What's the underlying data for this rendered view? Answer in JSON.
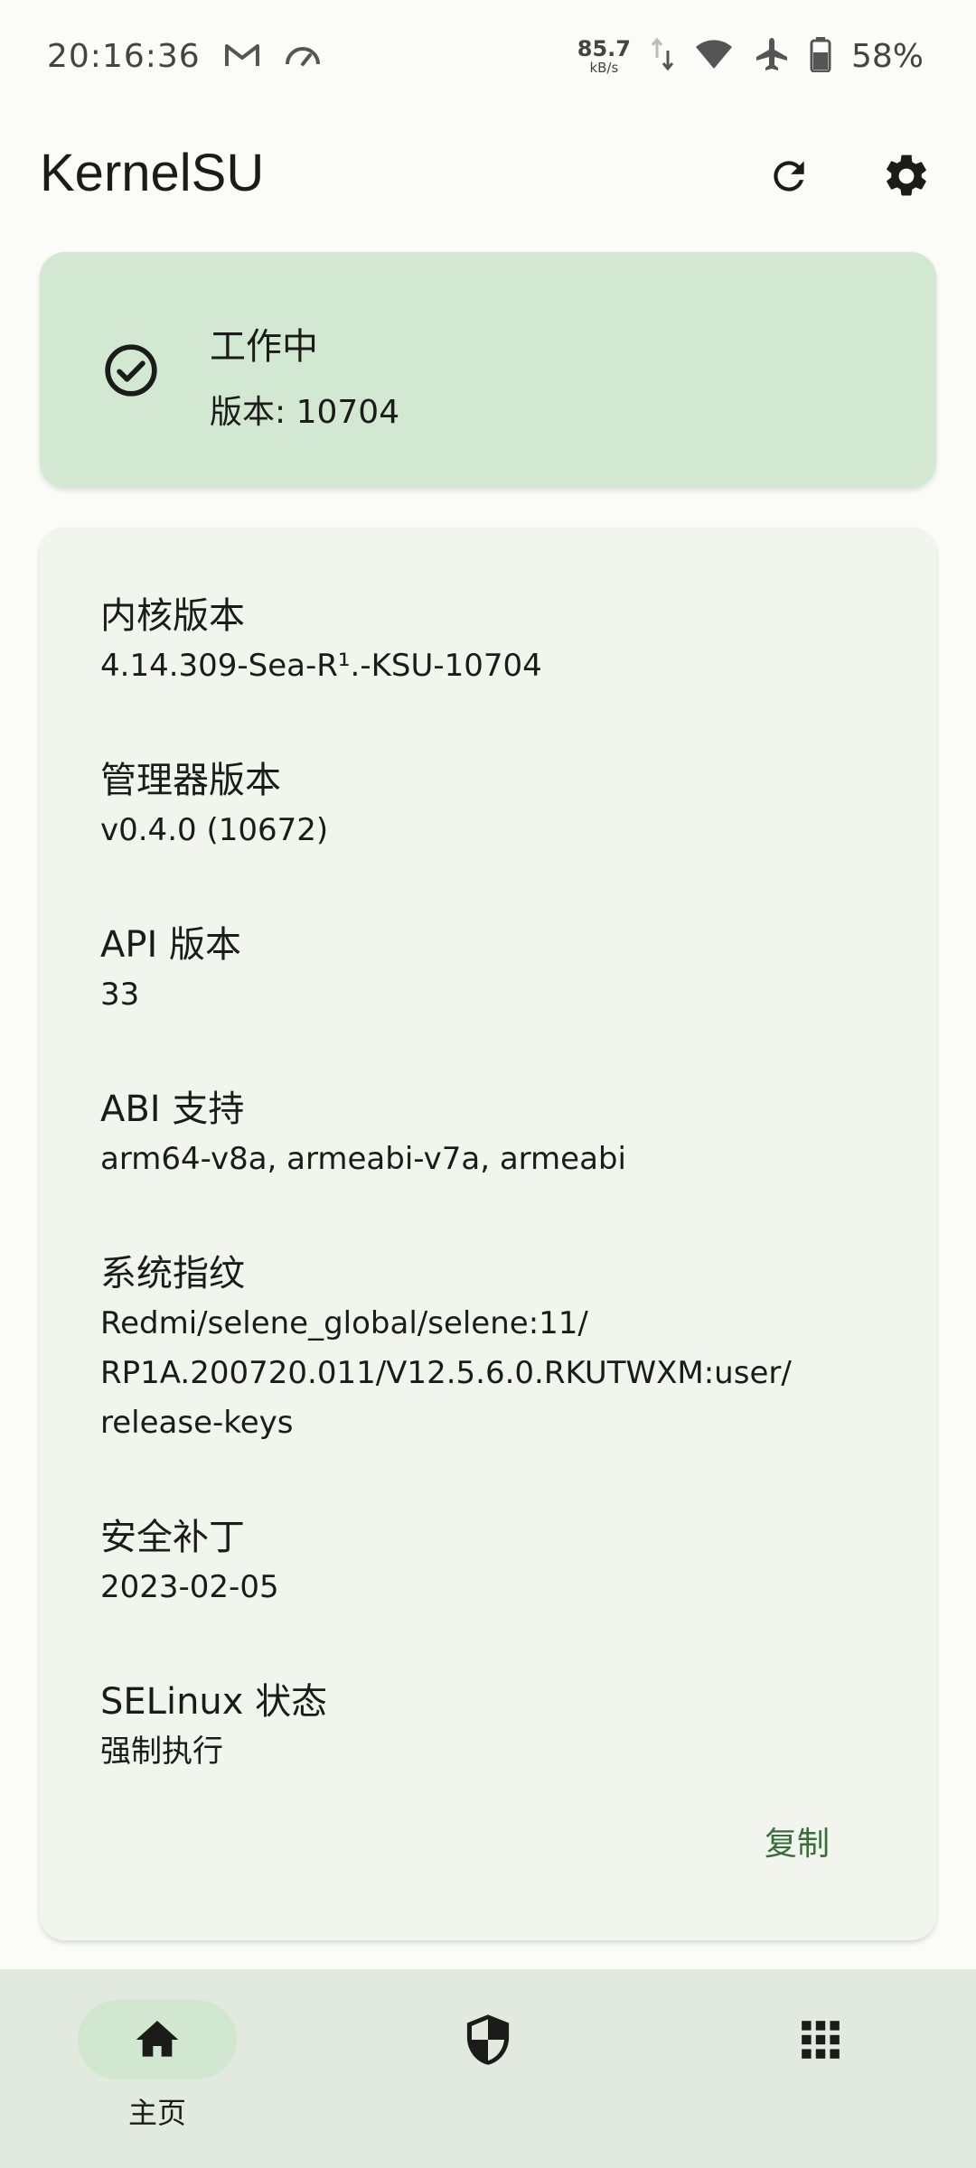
{
  "status_bar": {
    "time": "20:16:36",
    "net_speed_value": "85.7",
    "net_speed_unit": "kB/s",
    "battery_percent": "58%",
    "icons": [
      "gmail-icon",
      "speedometer-icon",
      "data-transfer-icon",
      "wifi-icon",
      "airplane-icon",
      "battery-icon"
    ]
  },
  "app_bar": {
    "title": "KernelSU",
    "actions": [
      "refresh-icon",
      "settings-gear-icon"
    ]
  },
  "status_card": {
    "title": "工作中",
    "version": "版本: 10704",
    "icon": "check-circle-icon",
    "color": "#d3e8d3"
  },
  "info": {
    "items": [
      {
        "label": "内核版本",
        "value": "4.14.309-Sea-R¹.-KSU-10704"
      },
      {
        "label": "管理器版本",
        "value": "v0.4.0 (10672)"
      },
      {
        "label": "API 版本",
        "value": "33"
      },
      {
        "label": "ABI 支持",
        "value": "arm64-v8a, armeabi-v7a, armeabi"
      },
      {
        "label": "系统指纹",
        "value_lines": [
          "Redmi/selene_global/selene:11/",
          "RP1A.200720.011/V12.5.6.0.RKUTWXM:user/",
          "release-keys"
        ]
      },
      {
        "label": "安全补丁",
        "value": "2023-02-05"
      },
      {
        "label": "SELinux 状态",
        "value": "强制执行"
      }
    ],
    "copy_label": "复制"
  },
  "bottom_nav": {
    "home_label": "主页",
    "icons": [
      "home-icon",
      "shield-icon",
      "apps-grid-icon"
    ],
    "accent": "#d1e7cf"
  }
}
